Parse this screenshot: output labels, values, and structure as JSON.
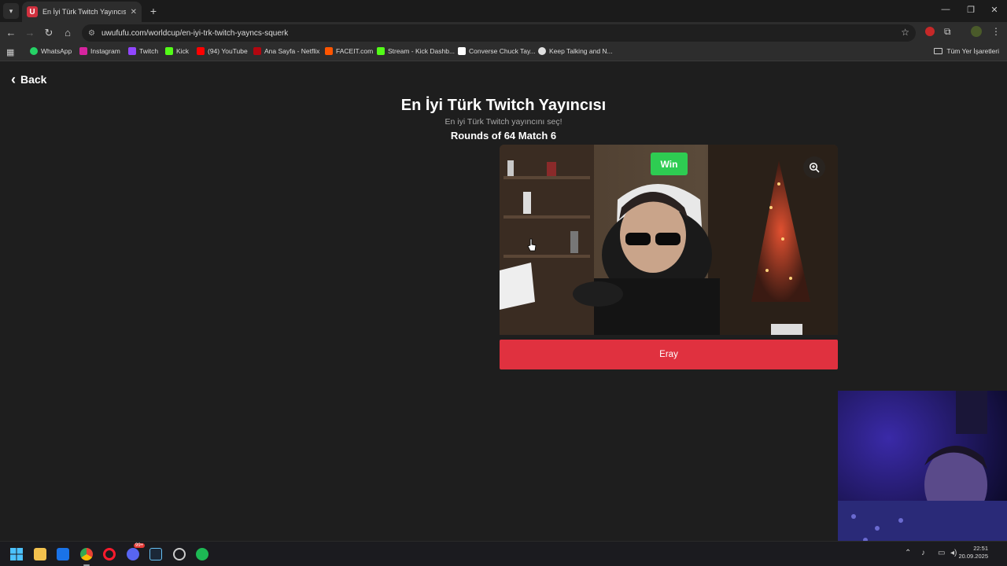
{
  "browser": {
    "tab": {
      "title": "En İyi Türk Twitch Yayıncısı | Uw…",
      "favicon_letter": "U",
      "close": "✕"
    },
    "new_tab": "+",
    "window_controls": {
      "minimize": "—",
      "restore": "❐",
      "close": "✕"
    },
    "url": "uwufufu.com/worldcup/en-iyi-trk-twitch-yayncs-squerk",
    "bookmarks": [
      {
        "label": "WhatsApp",
        "color": "#25d366"
      },
      {
        "label": "Instagram",
        "color": "#d6249f"
      },
      {
        "label": "Twitch",
        "color": "#9146ff"
      },
      {
        "label": "Kick",
        "color": "#53fc18"
      },
      {
        "label": "(94) YouTube",
        "color": "#ff0000"
      },
      {
        "label": "Ana Sayfa - Netflix",
        "color": "#b20710"
      },
      {
        "label": "FACEIT.com",
        "color": "#ff5500"
      },
      {
        "label": "Stream - Kick Dashb...",
        "color": "#53fc18"
      },
      {
        "label": "Converse Chuck Tay...",
        "color": "#ffffff"
      },
      {
        "label": "Keep Talking and N...",
        "color": "#e0e0e0"
      }
    ],
    "all_bookmarks": "Tüm Yer İşaretleri"
  },
  "page": {
    "back_label": "Back",
    "title": "En İyi Türk Twitch Yayıncısı",
    "subtitle": "En iyi Türk Twitch yayıncını seç!",
    "round": "Rounds of 64 Match 6",
    "candidate": {
      "win_label": "Win",
      "name": "Eray"
    }
  },
  "taskbar": {
    "clock_time": "22:51",
    "clock_date": "20.09.2025",
    "badge": "99+"
  },
  "colors": {
    "accent_red": "#e0313f",
    "win_green": "#2ecc52"
  }
}
